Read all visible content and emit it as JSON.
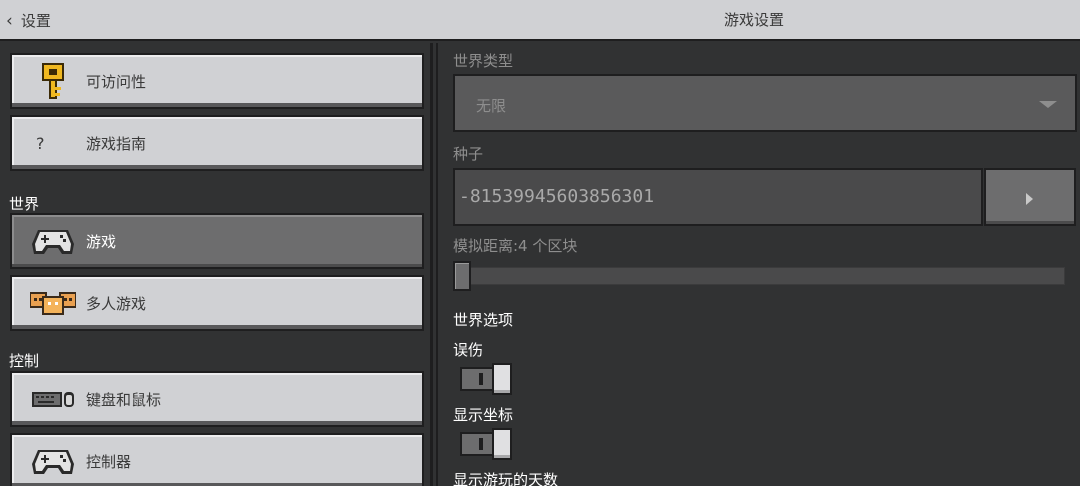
{
  "header": {
    "back_label": "设置",
    "title": "游戏设置"
  },
  "sidebar": {
    "items": [
      {
        "label": "可访问性",
        "icon": "key-icon"
      },
      {
        "label": "游戏指南",
        "icon": "question-icon",
        "glyph": "?"
      }
    ],
    "world_section": "世界",
    "world_items": [
      {
        "label": "游戏",
        "icon": "gamepad-icon",
        "active": true
      },
      {
        "label": "多人游戏",
        "icon": "multiplayer-icon"
      }
    ],
    "controls_section": "控制",
    "controls_items": [
      {
        "label": "键盘和鼠标",
        "icon": "keyboard-mouse-icon"
      },
      {
        "label": "控制器",
        "icon": "controller-icon"
      }
    ]
  },
  "main": {
    "world_type_label": "世界类型",
    "world_type_value": "无限",
    "seed_label": "种子",
    "seed_value": "-81539945603856301",
    "sim_distance_label": "模拟距离:4 个区块",
    "sim_distance_value": 4,
    "world_options_label": "世界选项",
    "friendly_fire_label": "误伤",
    "friendly_fire_on": false,
    "show_coords_label": "显示坐标",
    "show_coords_on": false,
    "show_days_label": "显示游玩的天数"
  },
  "colors": {
    "panel": "#313233",
    "button_light": "#d0d1d4",
    "button_active": "#6d6d6e",
    "border": "#1e1e1f"
  }
}
